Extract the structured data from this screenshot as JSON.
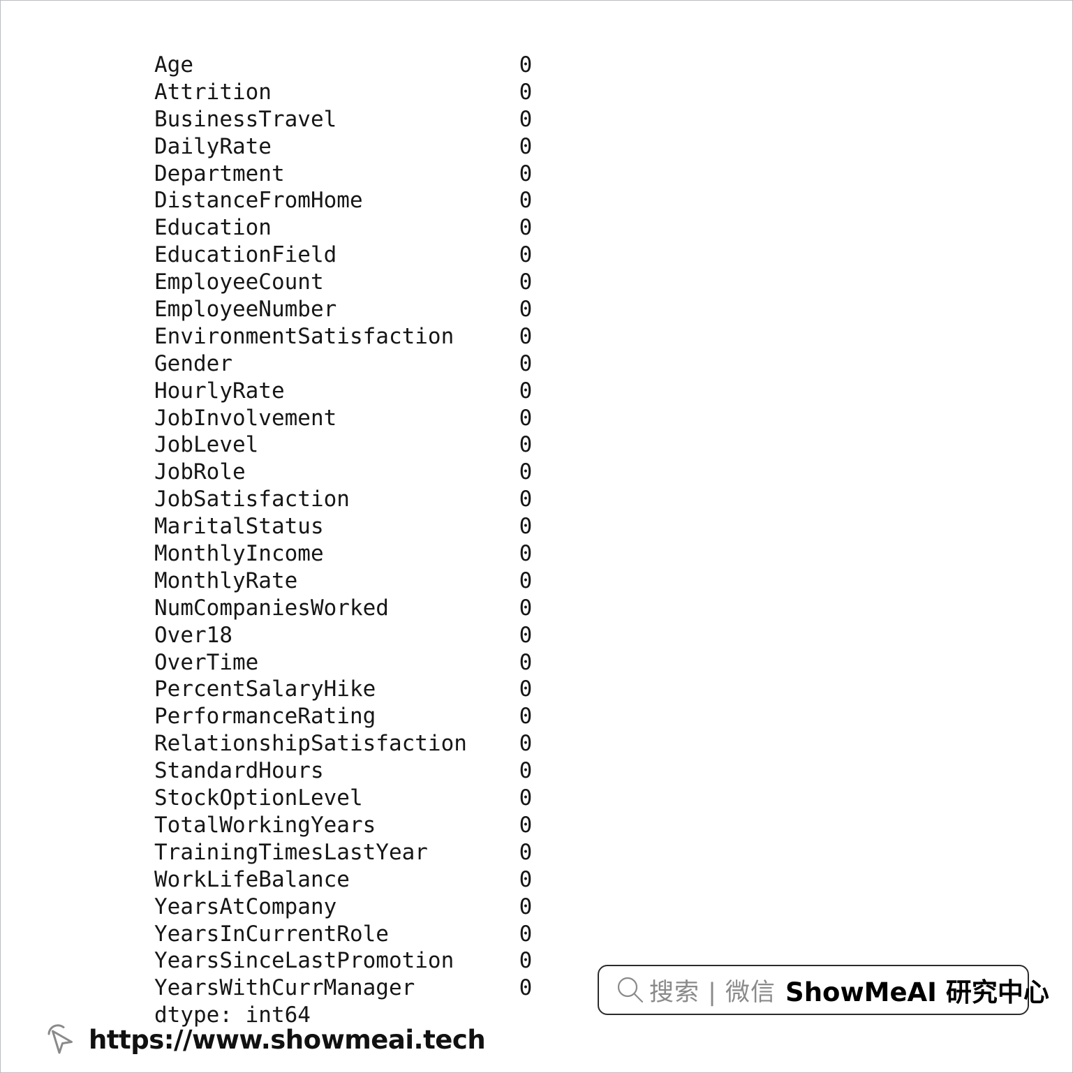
{
  "output": {
    "kind": "pandas-series",
    "index_column_width_chars": 28,
    "rows": [
      {
        "index": "Age",
        "value": "0"
      },
      {
        "index": "Attrition",
        "value": "0"
      },
      {
        "index": "BusinessTravel",
        "value": "0"
      },
      {
        "index": "DailyRate",
        "value": "0"
      },
      {
        "index": "Department",
        "value": "0"
      },
      {
        "index": "DistanceFromHome",
        "value": "0"
      },
      {
        "index": "Education",
        "value": "0"
      },
      {
        "index": "EducationField",
        "value": "0"
      },
      {
        "index": "EmployeeCount",
        "value": "0"
      },
      {
        "index": "EmployeeNumber",
        "value": "0"
      },
      {
        "index": "EnvironmentSatisfaction",
        "value": "0"
      },
      {
        "index": "Gender",
        "value": "0"
      },
      {
        "index": "HourlyRate",
        "value": "0"
      },
      {
        "index": "JobInvolvement",
        "value": "0"
      },
      {
        "index": "JobLevel",
        "value": "0"
      },
      {
        "index": "JobRole",
        "value": "0"
      },
      {
        "index": "JobSatisfaction",
        "value": "0"
      },
      {
        "index": "MaritalStatus",
        "value": "0"
      },
      {
        "index": "MonthlyIncome",
        "value": "0"
      },
      {
        "index": "MonthlyRate",
        "value": "0"
      },
      {
        "index": "NumCompaniesWorked",
        "value": "0"
      },
      {
        "index": "Over18",
        "value": "0"
      },
      {
        "index": "OverTime",
        "value": "0"
      },
      {
        "index": "PercentSalaryHike",
        "value": "0"
      },
      {
        "index": "PerformanceRating",
        "value": "0"
      },
      {
        "index": "RelationshipSatisfaction",
        "value": "0"
      },
      {
        "index": "StandardHours",
        "value": "0"
      },
      {
        "index": "StockOptionLevel",
        "value": "0"
      },
      {
        "index": "TotalWorkingYears",
        "value": "0"
      },
      {
        "index": "TrainingTimesLastYear",
        "value": "0"
      },
      {
        "index": "WorkLifeBalance",
        "value": "0"
      },
      {
        "index": "YearsAtCompany",
        "value": "0"
      },
      {
        "index": "YearsInCurrentRole",
        "value": "0"
      },
      {
        "index": "YearsSinceLastPromotion",
        "value": "0"
      },
      {
        "index": "YearsWithCurrManager",
        "value": "0"
      }
    ],
    "dtype_line": "dtype: int64"
  },
  "watermark": {
    "search_icon": "search-icon",
    "gray_text": "搜索 | 微信",
    "brand_text": "ShowMeAI 研究中心",
    "gray_color": "#8a8a8a",
    "brand_color": "#000000",
    "border_color": "#2b2b2b"
  },
  "footer": {
    "cursor_icon": "cursor-pointer-icon",
    "url": "https://www.showmeai.tech",
    "url_color": "#111111"
  },
  "colors": {
    "background": "#ffffff",
    "text": "#161616",
    "page_border": "#b9bcc0"
  }
}
